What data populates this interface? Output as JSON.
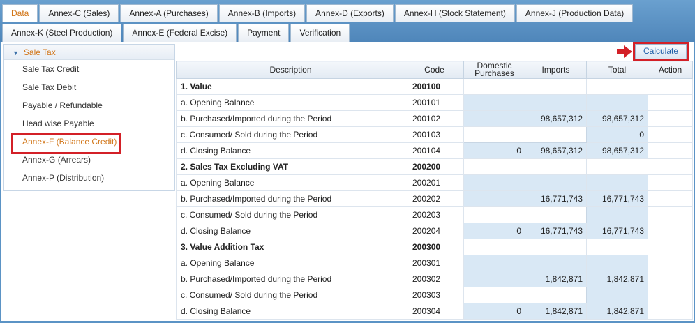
{
  "tabs_row1": [
    "Data",
    "Annex-C (Sales)",
    "Annex-A (Purchases)",
    "Annex-B (Imports)",
    "Annex-D (Exports)",
    "Annex-H (Stock Statement)",
    "Annex-J (Production Data)"
  ],
  "tabs_row2": [
    "Annex-K (Steel Production)",
    "Annex-E (Federal Excise)",
    "Payment",
    "Verification"
  ],
  "active_tab": "Data",
  "sidebar": {
    "header": "Sale Tax",
    "items": [
      "Sale Tax Credit",
      "Sale Tax Debit",
      "Payable / Refundable",
      "Head wise Payable",
      "Annex-F (Balance Credit)",
      "Annex-G (Arrears)",
      "Annex-P (Distribution)"
    ],
    "active_item": "Annex-F (Balance Credit)"
  },
  "toolbar": {
    "calculate_label": "Calculate"
  },
  "table": {
    "headers": {
      "description": "Description",
      "code": "Code",
      "domestic_line1": "Domestic",
      "domestic_line2": "Purchases",
      "imports": "Imports",
      "total": "Total",
      "action": "Action"
    },
    "rows": [
      {
        "description": "1. Value",
        "code": "200100",
        "group": true
      },
      {
        "description": "a. Opening Balance",
        "code": "200101",
        "domestic": "",
        "imports": "",
        "total": ""
      },
      {
        "description": "b. Purchased/Imported during the Period",
        "code": "200102",
        "domestic": "",
        "imports": "98,657,312",
        "total": "98,657,312"
      },
      {
        "description": "c. Consumed/ Sold during the Period",
        "code": "200103",
        "domestic": "",
        "imports": "",
        "total": "0"
      },
      {
        "description": "d. Closing Balance",
        "code": "200104",
        "domestic": "0",
        "imports": "98,657,312",
        "total": "98,657,312"
      },
      {
        "description": "2. Sales Tax Excluding VAT",
        "code": "200200",
        "group": true
      },
      {
        "description": "a. Opening Balance",
        "code": "200201",
        "domestic": "",
        "imports": "",
        "total": ""
      },
      {
        "description": "b. Purchased/Imported during the Period",
        "code": "200202",
        "domestic": "",
        "imports": "16,771,743",
        "total": "16,771,743"
      },
      {
        "description": "c. Consumed/ Sold during the Period",
        "code": "200203",
        "domestic": "",
        "imports": "",
        "total": ""
      },
      {
        "description": "d. Closing Balance",
        "code": "200204",
        "domestic": "0",
        "imports": "16,771,743",
        "total": "16,771,743"
      },
      {
        "description": "3. Value Addition Tax",
        "code": "200300",
        "group": true
      },
      {
        "description": "a. Opening Balance",
        "code": "200301",
        "domestic": "",
        "imports": "",
        "total": ""
      },
      {
        "description": "b. Purchased/Imported during the Period",
        "code": "200302",
        "domestic": "",
        "imports": "1,842,871",
        "total": "1,842,871"
      },
      {
        "description": "c. Consumed/ Sold during the Period",
        "code": "200303",
        "domestic": "",
        "imports": "",
        "total": ""
      },
      {
        "description": "d. Closing Balance",
        "code": "200304",
        "domestic": "0",
        "imports": "1,842,871",
        "total": "1,842,871"
      }
    ]
  },
  "colors": {
    "accent_orange": "#d2771a",
    "highlight_red": "#d32027",
    "input_blue": "#d9e8f5",
    "header_blue": "#5b93c5"
  }
}
